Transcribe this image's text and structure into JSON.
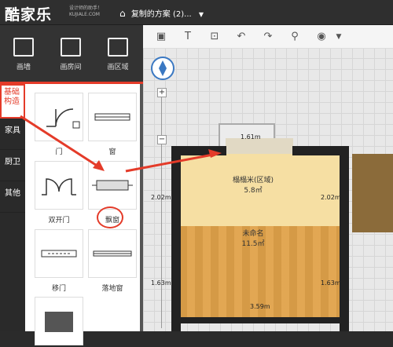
{
  "header": {
    "logo": "酷家乐",
    "logo_tag": "设计师的助手！",
    "logo_domain": "KUJIALE.COM",
    "project_title": "复制的方案 (2)..."
  },
  "toolbar": {
    "tools": [
      {
        "label": "画墙",
        "icon": "draw-wall-icon"
      },
      {
        "label": "画房间",
        "icon": "draw-room-icon"
      },
      {
        "label": "画区域",
        "icon": "draw-area-icon"
      }
    ]
  },
  "categories": [
    "基础构造",
    "家具",
    "厨卫",
    "其他"
  ],
  "library": {
    "items": [
      {
        "label": "门",
        "icon": "door-icon"
      },
      {
        "label": "窗",
        "icon": "window-icon"
      },
      {
        "label": "双开门",
        "icon": "double-door-icon"
      },
      {
        "label": "飘窗",
        "icon": "bay-window-icon"
      },
      {
        "label": "移门",
        "icon": "sliding-door-icon"
      },
      {
        "label": "落地窗",
        "icon": "floor-window-icon"
      }
    ]
  },
  "canvas": {
    "dims": {
      "top": "1.61m",
      "left": "2.02m",
      "right": "2.02m",
      "left_low": "1.63m",
      "right_low": "1.63m",
      "bottom": "3.59m"
    },
    "rooms": [
      {
        "name": "榻榻米(区域)",
        "area": "5.8㎡"
      },
      {
        "name": "未命名",
        "area": "11.5㎡"
      }
    ]
  },
  "colors": {
    "accent": "#e43b29",
    "compass": "#3a78c2"
  }
}
